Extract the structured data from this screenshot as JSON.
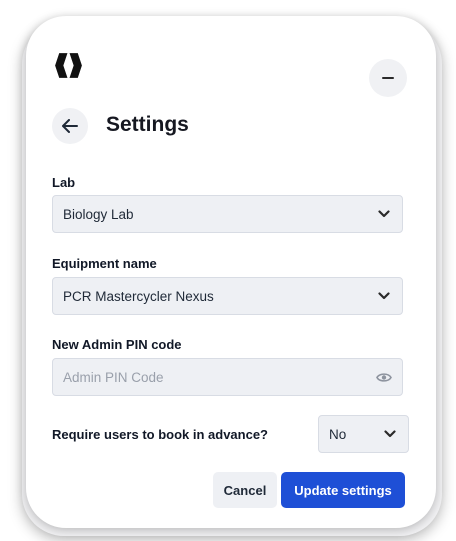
{
  "header": {
    "title": "Settings"
  },
  "form": {
    "lab": {
      "label": "Lab",
      "value": "Biology Lab"
    },
    "equipment": {
      "label": "Equipment name",
      "value": "PCR Mastercycler Nexus"
    },
    "pin": {
      "label": "New Admin PIN code",
      "placeholder": "Admin PIN Code",
      "value": ""
    },
    "advance_booking": {
      "label": "Require users to book in advance?",
      "value": "No"
    }
  },
  "actions": {
    "cancel_label": "Cancel",
    "submit_label": "Update settings"
  },
  "colors": {
    "primary": "#1e4fd6",
    "field_bg": "#eef0f4",
    "icon_button_bg": "#f0f1f4"
  },
  "icons": {
    "logo": "app-logo-icon",
    "minimize": "minimize-icon",
    "back": "arrow-left-icon",
    "dropdown": "chevron-down-icon",
    "reveal": "eye-icon"
  }
}
